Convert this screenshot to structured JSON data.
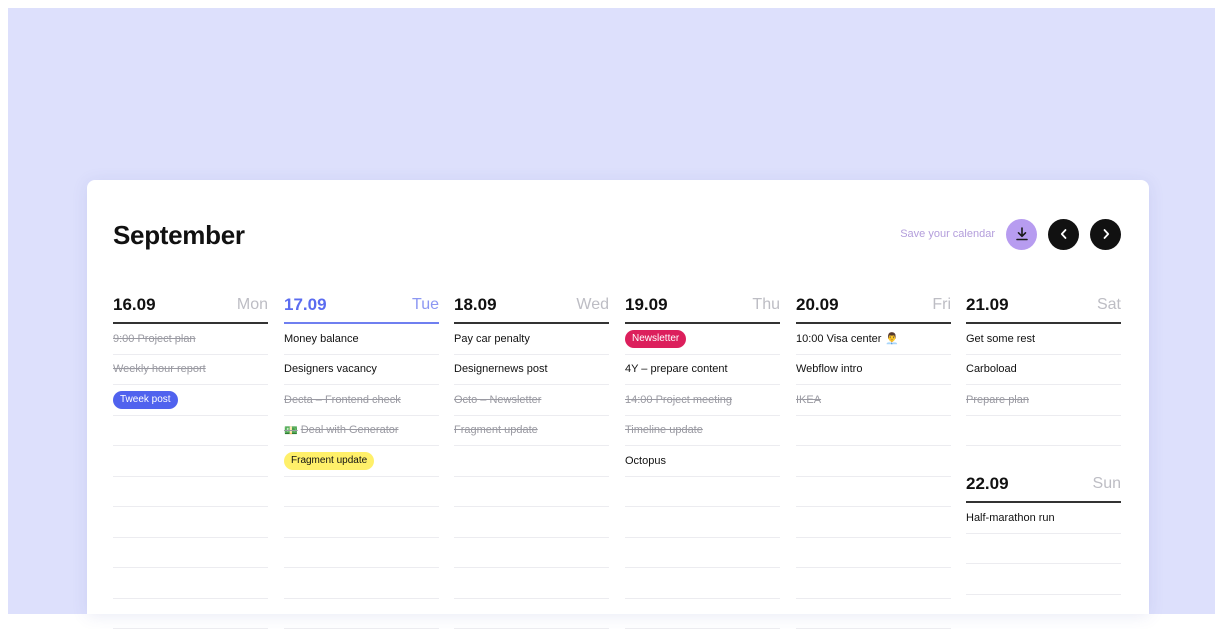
{
  "calendar": {
    "month": "September",
    "save_label": "Save your calendar",
    "colors": {
      "accent": "#5b6cf0",
      "download": "#b79cf0",
      "tag_blue": "#5062ee",
      "tag_red": "#dc1f5c",
      "tag_yellow": "#fff06a"
    }
  },
  "days": [
    {
      "date": "16.09",
      "name": "Mon",
      "items": [
        {
          "text": "9:00 Project plan",
          "done": true
        },
        {
          "text": "Weekly hour report",
          "done": true
        },
        {
          "text": "Tweek post",
          "tag": "blue"
        }
      ]
    },
    {
      "date": "17.09",
      "name": "Tue",
      "today": true,
      "items": [
        {
          "text": "Money balance"
        },
        {
          "text": "Designers vacancy"
        },
        {
          "text": "Decta – Frontend check",
          "done": true
        },
        {
          "text": "Deal with Generator",
          "done": true,
          "icon": "coin-stack-icon"
        },
        {
          "text": "Fragment update",
          "tag": "yellow"
        }
      ]
    },
    {
      "date": "18.09",
      "name": "Wed",
      "items": [
        {
          "text": "Pay car penalty"
        },
        {
          "text": "Designernews post"
        },
        {
          "text": "Octo – Newsletter",
          "done": true
        },
        {
          "text": "Fragment update",
          "done": true
        }
      ]
    },
    {
      "date": "19.09",
      "name": "Thu",
      "items": [
        {
          "text": "Newsletter",
          "tag": "red"
        },
        {
          "text": "4Y – prepare content"
        },
        {
          "text": "14:00 Project meeting",
          "done": true
        },
        {
          "text": "Timeline update",
          "done": true
        },
        {
          "text": "Octopus"
        }
      ]
    },
    {
      "date": "20.09",
      "name": "Fri",
      "items": [
        {
          "text": "10:00 Visa center",
          "icon": "person-icon"
        },
        {
          "text": "Webflow intro"
        },
        {
          "text": "IKEA",
          "done": true
        }
      ]
    },
    {
      "date": "21.09",
      "name": "Sat",
      "items": [
        {
          "text": "Get some rest"
        },
        {
          "text": "Carboload"
        },
        {
          "text": "Prepare plan",
          "done": true
        }
      ]
    },
    {
      "date": "22.09",
      "name": "Sun",
      "items": [
        {
          "text": "Half-marathon run"
        }
      ]
    }
  ]
}
